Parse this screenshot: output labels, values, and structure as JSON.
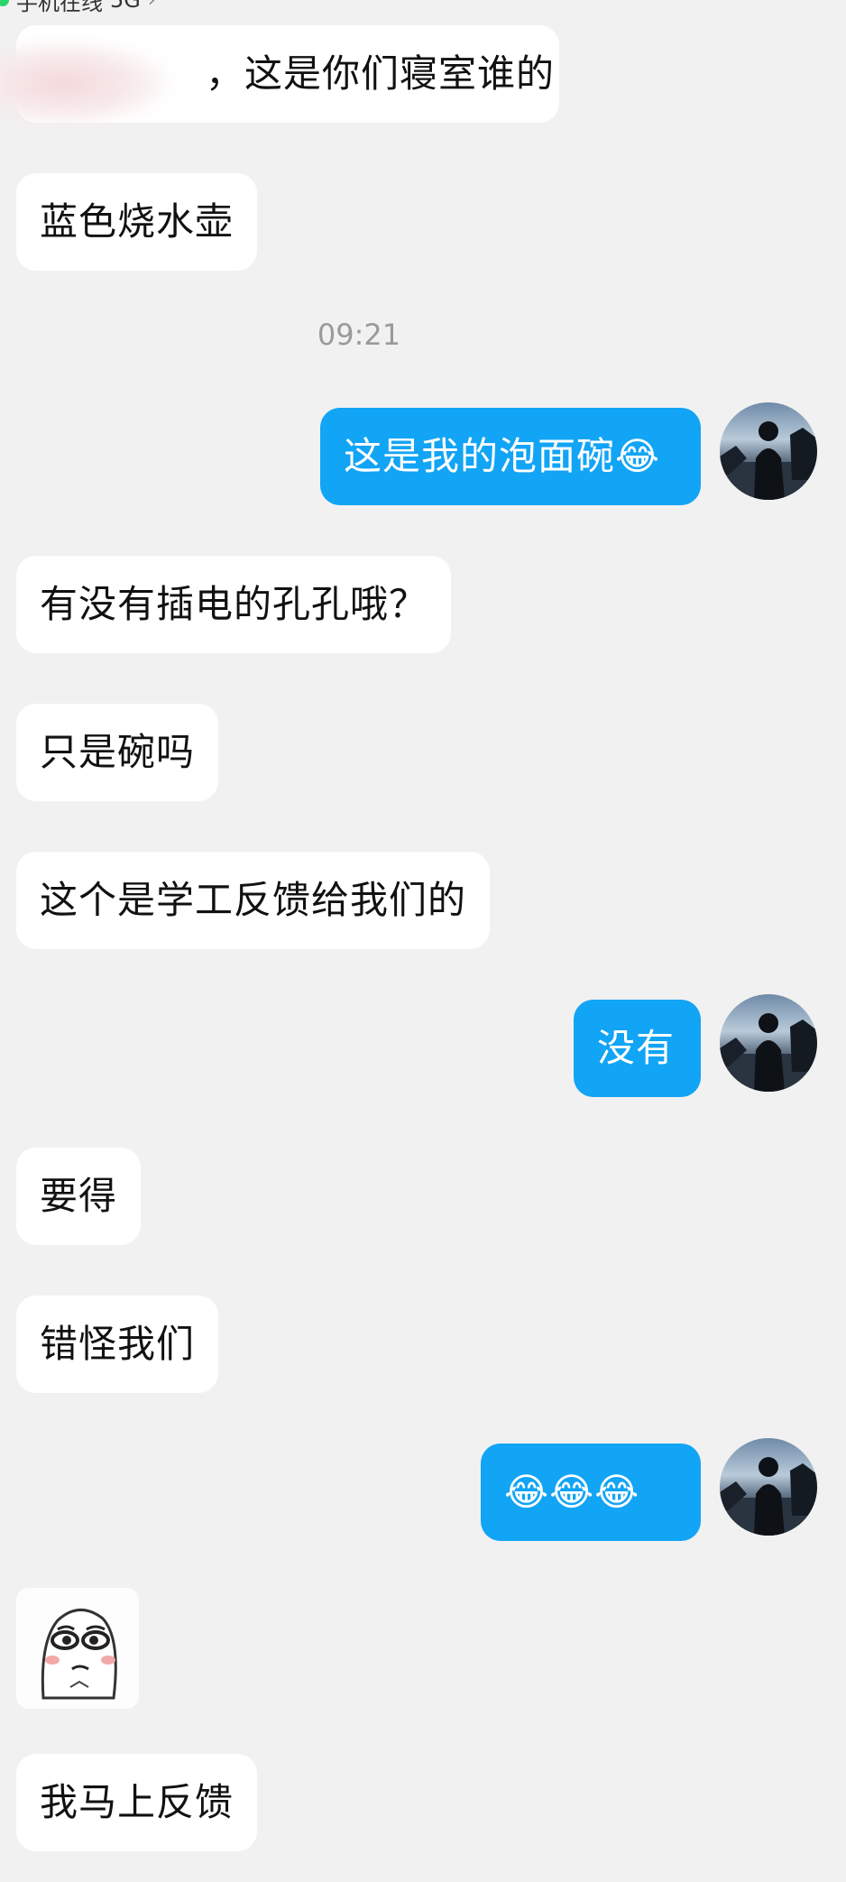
{
  "status_bar": {
    "presence": "手机在线",
    "network": "5G"
  },
  "messages": [
    {
      "side": "in",
      "text": "，这是你们寝室谁的"
    },
    {
      "side": "in",
      "text": "蓝色烧水壶"
    },
    {
      "side": "out",
      "text": "这是我的泡面碗😂"
    },
    {
      "side": "in",
      "text": "有没有插电的孔孔哦？"
    },
    {
      "side": "in",
      "text": "只是碗吗"
    },
    {
      "side": "in",
      "text": "这个是学工反馈给我们的"
    },
    {
      "side": "out",
      "text": "没有"
    },
    {
      "side": "in",
      "text": "要得"
    },
    {
      "side": "in",
      "text": "错怪我们"
    },
    {
      "side": "out",
      "text": "😂😂😂"
    },
    {
      "side": "in",
      "type": "sticker",
      "icon": "meme-face-sticker"
    },
    {
      "side": "in",
      "text": "我马上反馈"
    }
  ],
  "timestamp": "09:21",
  "colors": {
    "background": "#f1f1f1",
    "incoming_bubble": "#ffffff",
    "outgoing_bubble": "#12a4f5"
  }
}
